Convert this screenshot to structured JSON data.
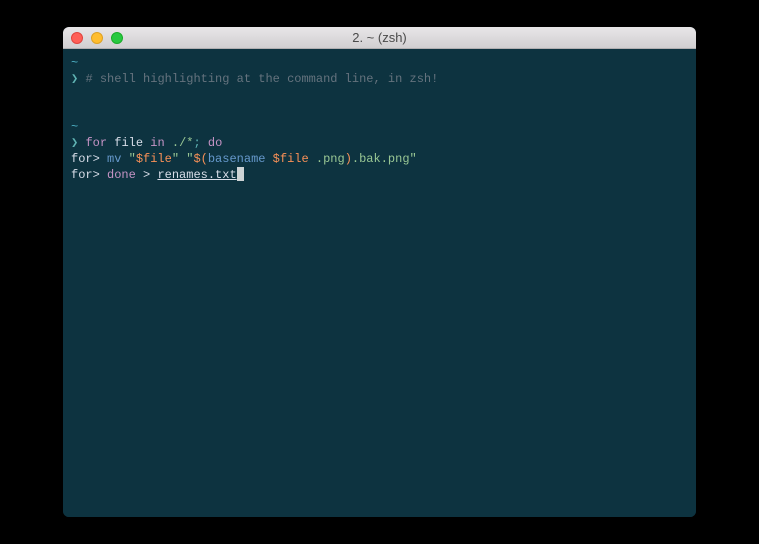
{
  "window": {
    "title": "2. ~ (zsh)"
  },
  "terminal": {
    "tilde": "~",
    "prompt_glyph": "❯",
    "cont_prompt": "for>",
    "line1": {
      "comment": "# shell highlighting at the command line, in zsh!"
    },
    "line2": {
      "kw_for": "for",
      "var": "file",
      "kw_in": "in",
      "path": "./*",
      "semi": ";",
      "kw_do": "do"
    },
    "line3": {
      "cmd": "mv",
      "q1": "\"",
      "var1": "$file",
      "q2": "\"",
      "sp": " ",
      "q3": "\"",
      "sub_open": "$(",
      "basename": "basename",
      "var2": "$file",
      "ext": ".png",
      "sub_close": ")",
      "suffix": ".bak.png",
      "q4": "\""
    },
    "line4": {
      "kw_done": "done",
      "redir": ">",
      "outfile": "renames.txt"
    }
  }
}
